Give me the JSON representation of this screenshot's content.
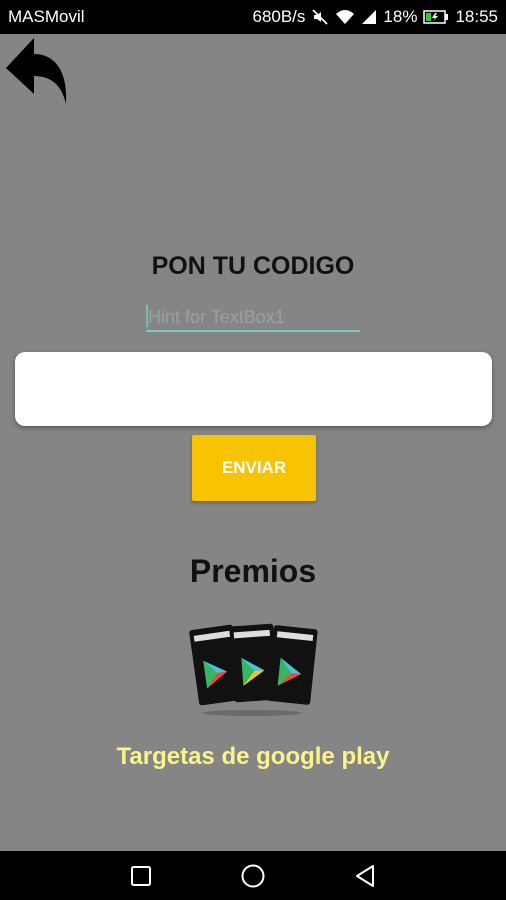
{
  "status_bar": {
    "carrier": "MASMovil",
    "speed": "680B/s",
    "battery": "18%",
    "time": "18:55"
  },
  "icons": {
    "back": "back-arrow-icon",
    "mute": "mute-icon",
    "wifi": "wifi-icon",
    "signal": "signal-icon",
    "battery": "battery-charging-icon",
    "nav_recents": "square-icon",
    "nav_home": "circle-icon",
    "nav_back": "triangle-back-icon",
    "cards": "google-play-cards-icon"
  },
  "form": {
    "title": "PON TU CODIGO",
    "hint": "Hint for TextBox1",
    "code_value": "",
    "send_label": "ENVIAR"
  },
  "prizes": {
    "heading": "Premios",
    "caption": "Targetas de google play"
  },
  "colors": {
    "background": "#858585",
    "button": "#f8c300",
    "caption": "#fcf38a",
    "underline": "#7fc8c0"
  }
}
